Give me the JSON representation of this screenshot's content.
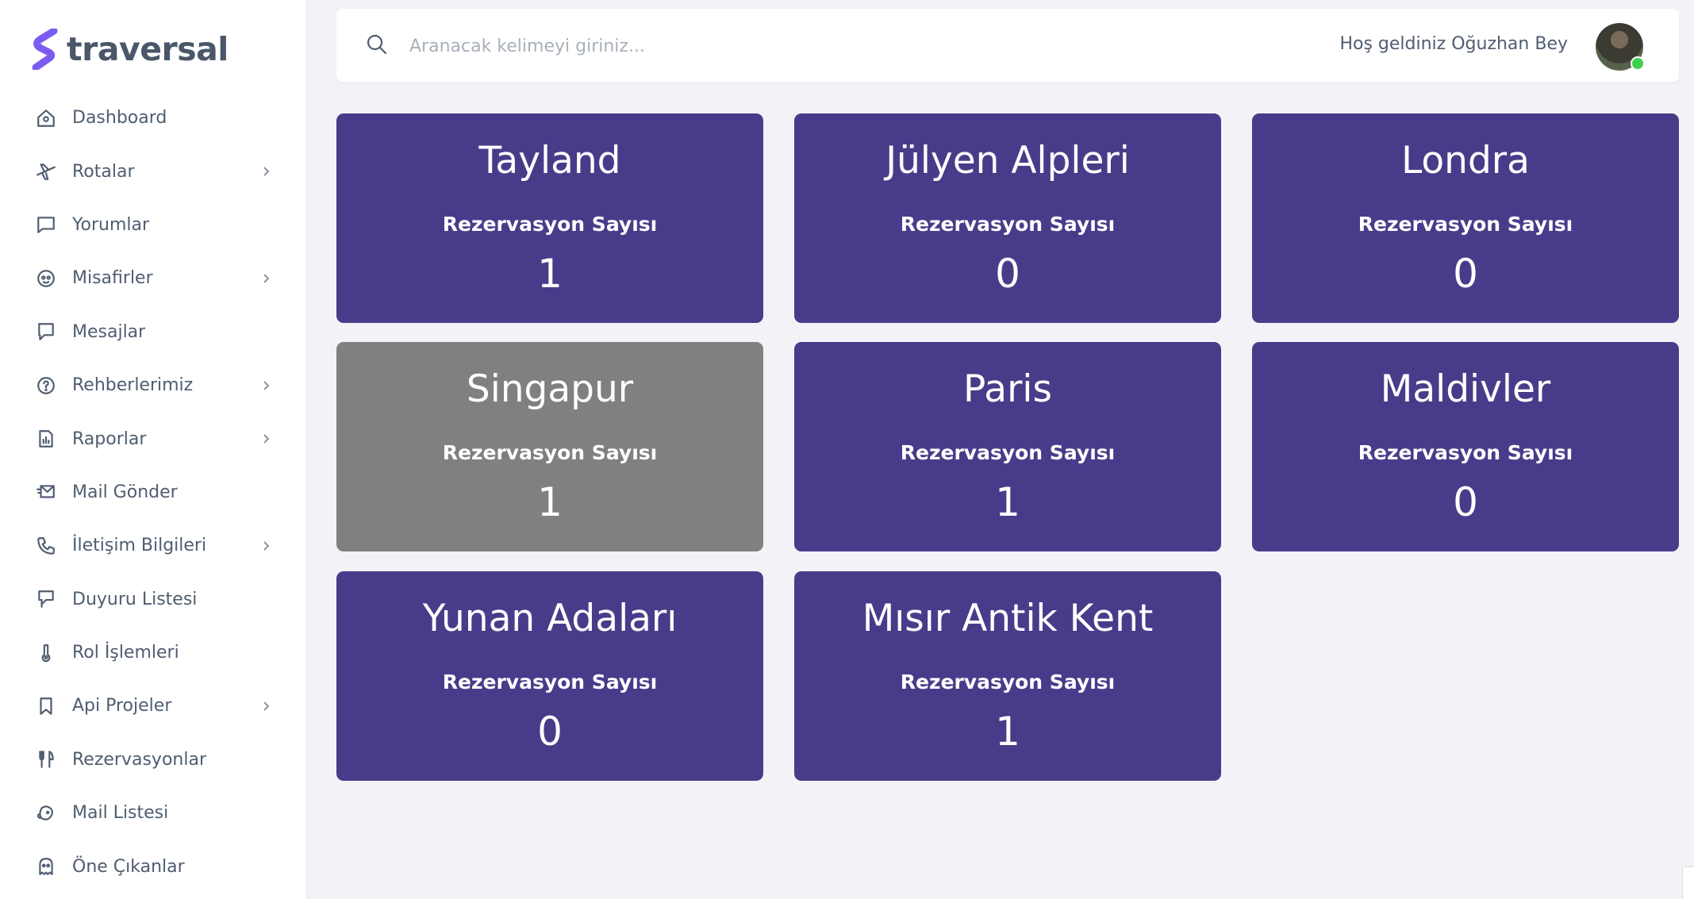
{
  "brand": {
    "name": "traversal",
    "color": "#7c5cf0"
  },
  "sidebar": {
    "items": [
      {
        "label": "Dashboard",
        "icon": "home-icon",
        "has_submenu": false
      },
      {
        "label": "Rotalar",
        "icon": "airplane-icon",
        "has_submenu": true
      },
      {
        "label": "Yorumlar",
        "icon": "comment-icon",
        "has_submenu": false
      },
      {
        "label": "Misafirler",
        "icon": "face-icon",
        "has_submenu": true
      },
      {
        "label": "Mesajlar",
        "icon": "message-icon",
        "has_submenu": false
      },
      {
        "label": "Rehberlerimiz",
        "icon": "help-circle-icon",
        "has_submenu": true
      },
      {
        "label": "Raporlar",
        "icon": "report-icon",
        "has_submenu": true
      },
      {
        "label": "Mail Gönder",
        "icon": "mail-send-icon",
        "has_submenu": false
      },
      {
        "label": "İletişim Bilgileri",
        "icon": "phone-icon",
        "has_submenu": true
      },
      {
        "label": "Duyuru Listesi",
        "icon": "announcement-icon",
        "has_submenu": false
      },
      {
        "label": "Rol İşlemleri",
        "icon": "thermometer-key-icon",
        "has_submenu": false
      },
      {
        "label": "Api Projeler",
        "icon": "bookmark-icon",
        "has_submenu": true
      },
      {
        "label": "Rezervasyonlar",
        "icon": "cutlery-icon",
        "has_submenu": false
      },
      {
        "label": "Mail Listesi",
        "icon": "mailchimp-icon",
        "has_submenu": false
      },
      {
        "label": "Öne Çıkanlar",
        "icon": "ghost-icon",
        "has_submenu": false
      }
    ]
  },
  "header": {
    "search_placeholder": "Aranacak kelimeyi giriniz...",
    "welcome_text": "Hoş geldiniz Oğuzhan Bey",
    "online_status_color": "#3ecf4e"
  },
  "cards": [
    {
      "title": "Tayland",
      "subtitle": "Rezervasyon Sayısı",
      "count": "1",
      "color": "#483c8a"
    },
    {
      "title": "Jülyen Alpleri",
      "subtitle": "Rezervasyon Sayısı",
      "count": "0",
      "color": "#483c8a"
    },
    {
      "title": "Londra",
      "subtitle": "Rezervasyon Sayısı",
      "count": "0",
      "color": "#483c8a"
    },
    {
      "title": "Singapur",
      "subtitle": "Rezervasyon Sayısı",
      "count": "1",
      "color": "#808080"
    },
    {
      "title": "Paris",
      "subtitle": "Rezervasyon Sayısı",
      "count": "1",
      "color": "#483c8a"
    },
    {
      "title": "Maldivler",
      "subtitle": "Rezervasyon Sayısı",
      "count": "0",
      "color": "#483c8a"
    },
    {
      "title": "Yunan Adaları",
      "subtitle": "Rezervasyon Sayısı",
      "count": "0",
      "color": "#483c8a"
    },
    {
      "title": "Mısır Antik Kent",
      "subtitle": "Rezervasyon Sayısı",
      "count": "1",
      "color": "#483c8a"
    }
  ]
}
